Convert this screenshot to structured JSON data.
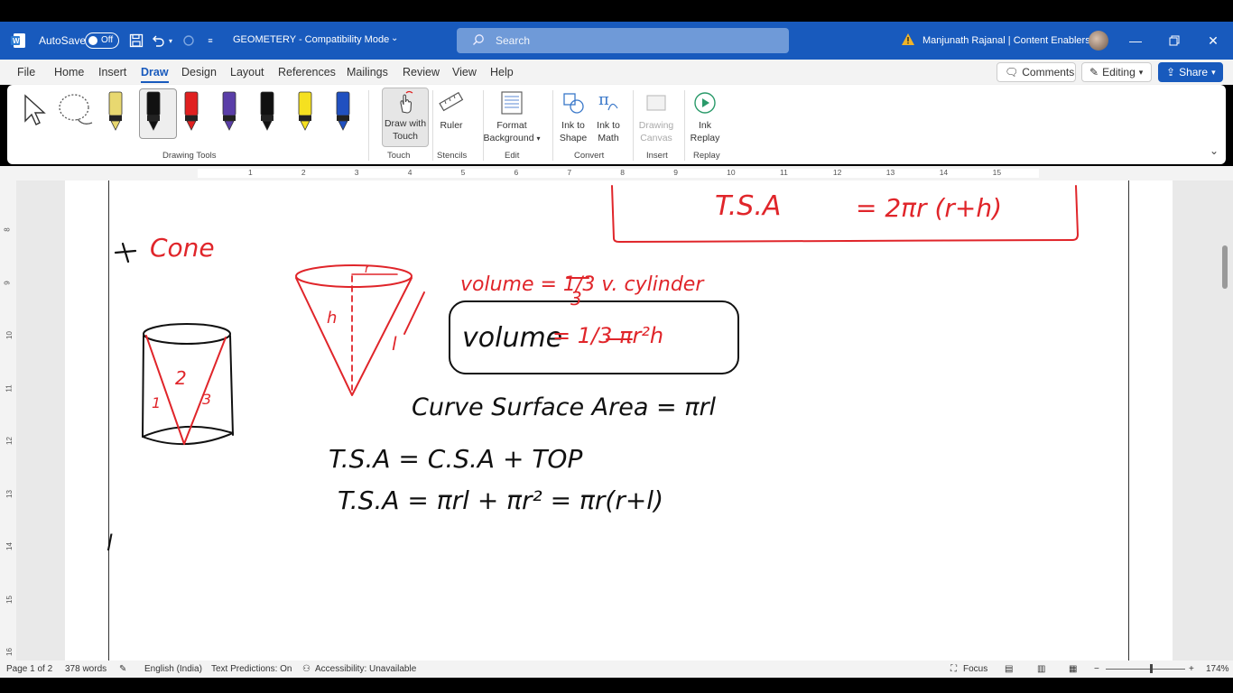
{
  "titlebar": {
    "autosave_label": "AutoSave",
    "autosave_state": "Off",
    "doc_title": "GEOMETERY  -  Compatibility Mode",
    "search_placeholder": "Search",
    "user_name": "Manjunath Rajanal | Content Enablers"
  },
  "menu": {
    "tabs": [
      "File",
      "Home",
      "Insert",
      "Draw",
      "Design",
      "Layout",
      "References",
      "Mailings",
      "Review",
      "View",
      "Help"
    ],
    "active_tab": "Draw",
    "comments_label": "Comments",
    "editing_label": "Editing",
    "share_label": "Share"
  },
  "ribbon": {
    "groups": {
      "drawing_tools": "Drawing Tools",
      "touch": "Touch",
      "stencils": "Stencils",
      "edit": "Edit",
      "convert": "Convert",
      "insert": "Insert",
      "replay": "Replay"
    },
    "buttons": {
      "draw_with_touch_1": "Draw with",
      "draw_with_touch_2": "Touch",
      "ruler": "Ruler",
      "format_bg_1": "Format",
      "format_bg_2": "Background",
      "ink_to_shape_1": "Ink to",
      "ink_to_shape_2": "Shape",
      "ink_to_math_1": "Ink to",
      "ink_to_math_2": "Math",
      "drawing_canvas_1": "Drawing",
      "drawing_canvas_2": "Canvas",
      "ink_replay_1": "Ink",
      "ink_replay_2": "Replay"
    },
    "pen_colors": [
      "#e8d870",
      "#111111",
      "#e02020",
      "#5a3ea8",
      "#111111",
      "#f5e020",
      "#2050c0"
    ]
  },
  "ruler": {
    "numbers": [
      "1",
      "2",
      "3",
      "4",
      "5",
      "6",
      "7",
      "8",
      "9",
      "10",
      "11",
      "12",
      "13",
      "14",
      "15"
    ],
    "vnumbers": [
      "8",
      "9",
      "10",
      "11",
      "12",
      "13",
      "14",
      "15",
      "16"
    ]
  },
  "ink": {
    "cone_heading": "Cone",
    "label_h": "h",
    "label_r": "r",
    "label_l": "l",
    "vol_ref": "volume = 1/3 v. cylinder",
    "vol_frac_1": "1",
    "vol_frac_3": "3",
    "vol_word": "volume",
    "vol_formula": "= 1/3 πr²h",
    "csa_line": "Curve Surface Area = πrl",
    "tsa_line1": "T.S.A = C.S.A + TOP",
    "tsa_line2": "T.S.A = πrl + πr² = πr(r+l)",
    "top_box_left": "T.S.A",
    "top_box_right": "= 2πr (r+h)",
    "cyl_1": "1",
    "cyl_2": "2",
    "cyl_3": "3"
  },
  "status": {
    "page": "Page 1 of 2",
    "words": "378 words",
    "language": "English (India)",
    "text_predictions": "Text Predictions: On",
    "accessibility": "Accessibility: Unavailable",
    "focus": "Focus",
    "zoom": "174%"
  },
  "colors": {
    "brand": "#185abd",
    "ink_red": "#e0252a",
    "ink_black": "#111111"
  }
}
